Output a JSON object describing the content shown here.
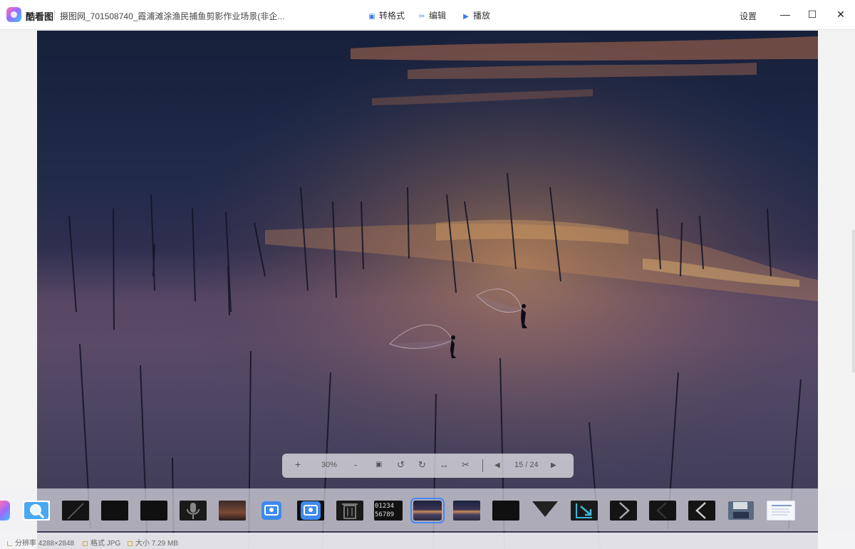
{
  "app": {
    "name": "酷看图",
    "file_title": "摄图网_701508740_霞浦滩涂渔民捕鱼剪影作业场景(非企..."
  },
  "toolbar": {
    "convert_label": "转格式",
    "edit_label": "编辑",
    "play_label": "播放",
    "settings_label": "设置"
  },
  "window_controls": {
    "minimize": "—",
    "maximize": "☐",
    "close": "✕"
  },
  "zoom_bar": {
    "zoom_in": "+",
    "zoom_level": "30%",
    "zoom_out": "-",
    "fit_icon": "▣",
    "rotate_left": "↺",
    "rotate_right": "↻",
    "flip": "↔",
    "crop": "✂",
    "prev": "◀",
    "page_indicator": "15 / 24",
    "next": "▶"
  },
  "filmstrip": {
    "active_index": 11,
    "thumbnails": [
      {
        "kind": "partial-app-icon"
      },
      {
        "kind": "zoom-icon"
      },
      {
        "kind": "dark-diagonal"
      },
      {
        "kind": "dark"
      },
      {
        "kind": "dark"
      },
      {
        "kind": "microphone-icon"
      },
      {
        "kind": "movie-poster"
      },
      {
        "kind": "photo-app-icon"
      },
      {
        "kind": "photo-app-icon"
      },
      {
        "kind": "trash-icon"
      },
      {
        "kind": "digits",
        "text": "01234 56789"
      },
      {
        "kind": "sunset-photo"
      },
      {
        "kind": "sunset-photo"
      },
      {
        "kind": "dark"
      },
      {
        "kind": "triangle-down-icon"
      },
      {
        "kind": "arrow-down-right-icon"
      },
      {
        "kind": "chevron-right-icon"
      },
      {
        "kind": "chevron-left-icon"
      },
      {
        "kind": "chevron-left-icon"
      },
      {
        "kind": "floppy-disk-icon"
      },
      {
        "kind": "document"
      }
    ]
  },
  "status": {
    "resolution_label": "分辨率",
    "resolution_value": "4288×2848",
    "format_label": "格式",
    "format_value": "JPG",
    "size_label": "大小",
    "size_value": "7.29 MB"
  },
  "colors": {
    "accent": "#3a7bea",
    "active_outline": "#4a86f0",
    "status_icon": "#d2a94a"
  }
}
